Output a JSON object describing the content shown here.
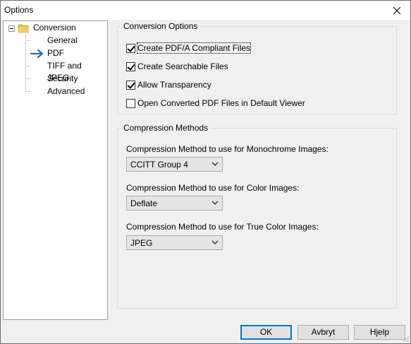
{
  "window": {
    "title": "Options",
    "close_symbol": "✕"
  },
  "tree": {
    "root": "Conversion",
    "items": [
      {
        "label": "General"
      },
      {
        "label": "PDF",
        "selected": true
      },
      {
        "label": "TIFF and JPEG"
      },
      {
        "label": "Security"
      },
      {
        "label": "Advanced"
      }
    ]
  },
  "conversion_options": {
    "title": "Conversion Options",
    "checkboxes": [
      {
        "label": "Create PDF/A Compliant Files",
        "checked": true
      },
      {
        "label": "Create Searchable Files",
        "checked": true
      },
      {
        "label": "Allow Transparency",
        "checked": true
      },
      {
        "label": "Open Converted PDF Files in Default Viewer",
        "checked": false
      }
    ]
  },
  "compression": {
    "title": "Compression Methods",
    "mono_label": "Compression Method to use for Monochrome Images:",
    "mono_value": "CCITT Group 4",
    "color_label": "Compression Method to use for Color Images:",
    "color_value": "Deflate",
    "truecolor_label": "Compression Method to use for True Color Images:",
    "truecolor_value": "JPEG"
  },
  "buttons": {
    "ok": "OK",
    "cancel": "Avbryt",
    "help": "Hjelp"
  },
  "colors": {
    "selected_arrow": "#2c6bb8",
    "folder": "#e8b84a",
    "default_button_border": "#0078d7"
  },
  "icons": {
    "folder": "folder-icon",
    "arrow": "arrow-right-icon",
    "close": "close-icon",
    "chevron": "chevron-down-icon"
  }
}
